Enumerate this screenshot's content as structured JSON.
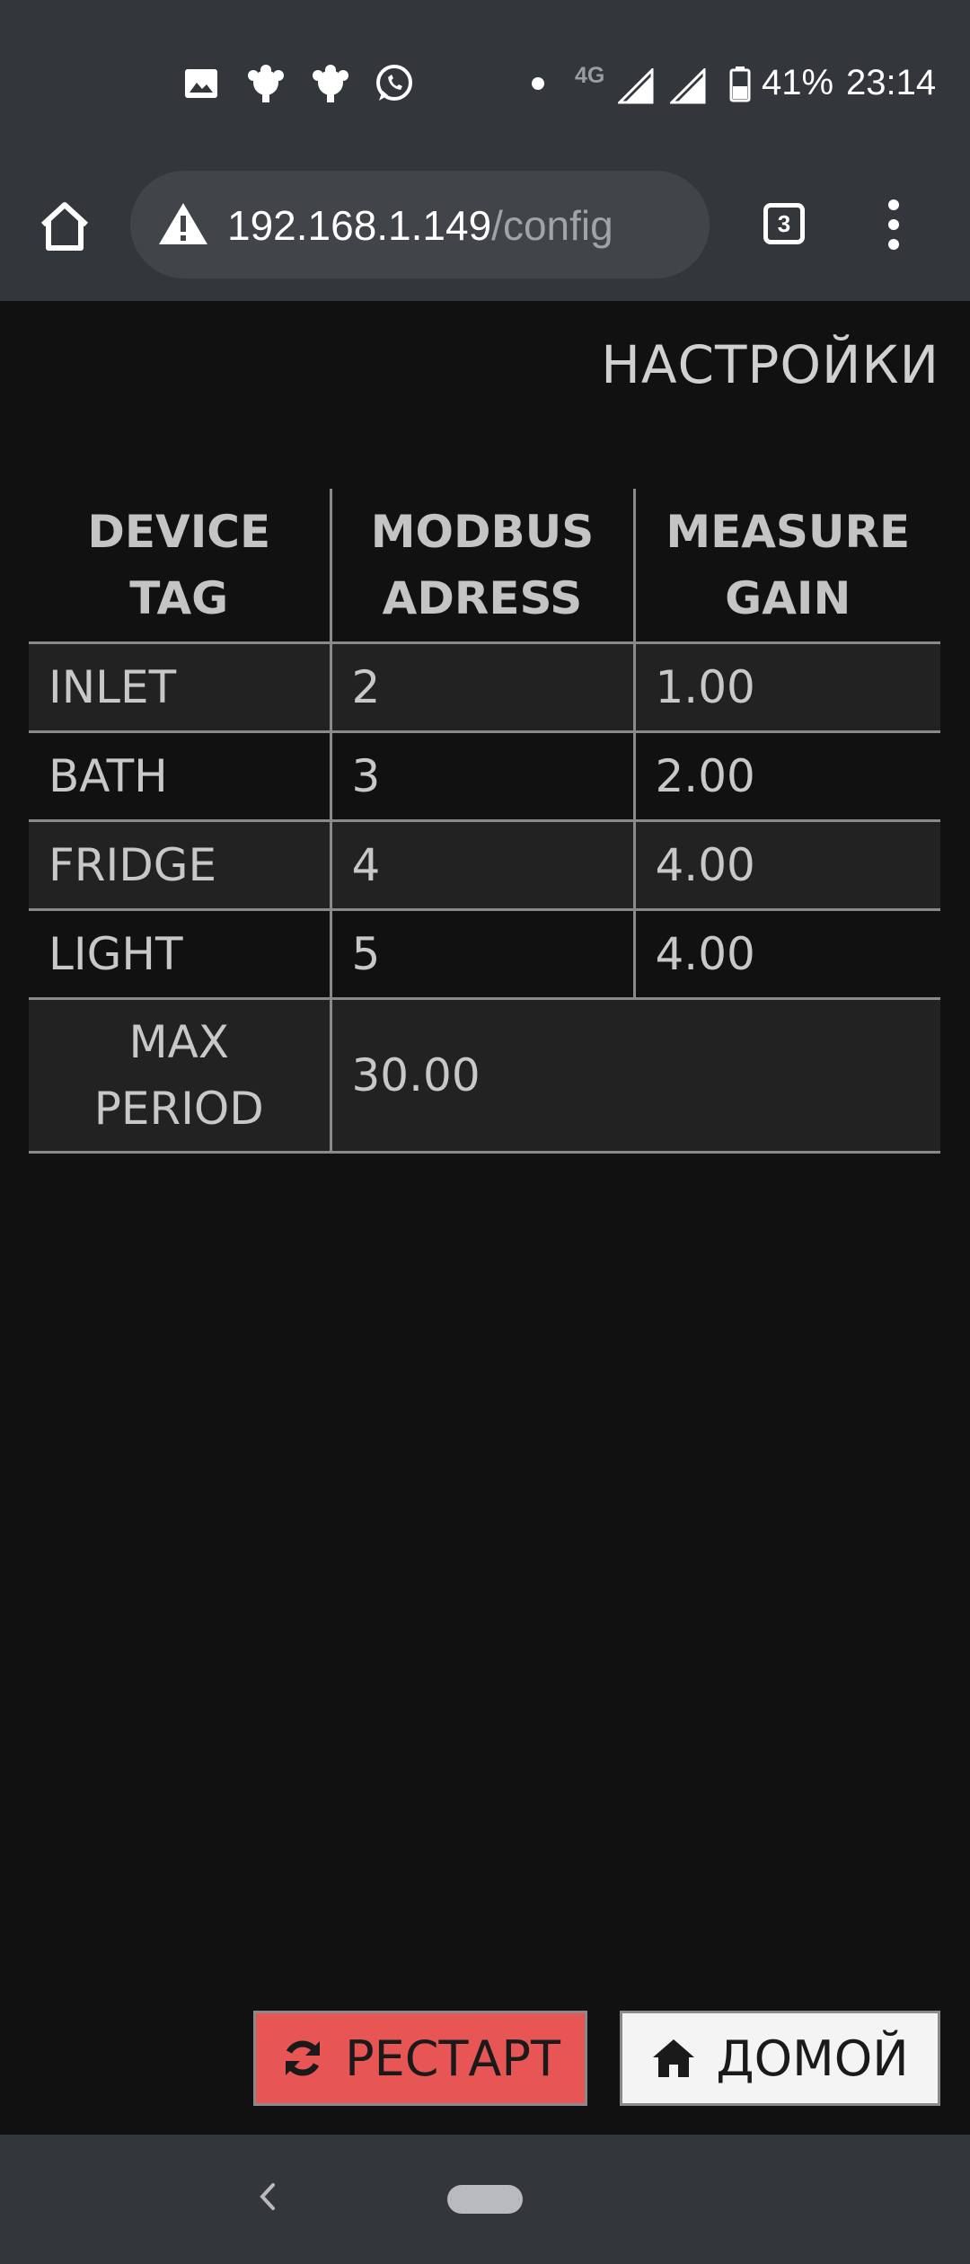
{
  "status_bar": {
    "network_type": "4G",
    "battery": "41%",
    "time": "23:14",
    "icons": [
      "gallery-icon",
      "app-notification-icon",
      "app-notification-icon",
      "whatsapp-icon",
      "signal-icon",
      "signal-icon",
      "battery-icon"
    ]
  },
  "browser": {
    "url_host": "192.168.1.149",
    "url_path": "/config",
    "tab_count": "3",
    "icons": [
      "home-icon",
      "warning-icon",
      "tabs-icon",
      "more-vert-icon"
    ]
  },
  "page": {
    "title": "НАСТРОЙКИ",
    "table": {
      "headers": [
        [
          "DEVICE",
          "TAG"
        ],
        [
          "MODBUS",
          "ADRESS"
        ],
        [
          "MEASURE",
          "GAIN"
        ]
      ],
      "rows": [
        {
          "tag": "INLET",
          "address": "2",
          "gain": "1.00"
        },
        {
          "tag": "BATH",
          "address": "3",
          "gain": "2.00"
        },
        {
          "tag": "FRIDGE",
          "address": "4",
          "gain": "4.00"
        },
        {
          "tag": "LIGHT",
          "address": "5",
          "gain": "4.00"
        }
      ],
      "max_period": {
        "label": [
          "MAX",
          "PERIOD"
        ],
        "value": "30.00"
      }
    },
    "buttons": {
      "restart": "РЕСТАРТ",
      "home": "ДОМОЙ"
    }
  },
  "colors": {
    "background": "#111111",
    "chrome": "#33363b",
    "restart_button": "#e85555",
    "home_button": "#f4f4f4"
  }
}
